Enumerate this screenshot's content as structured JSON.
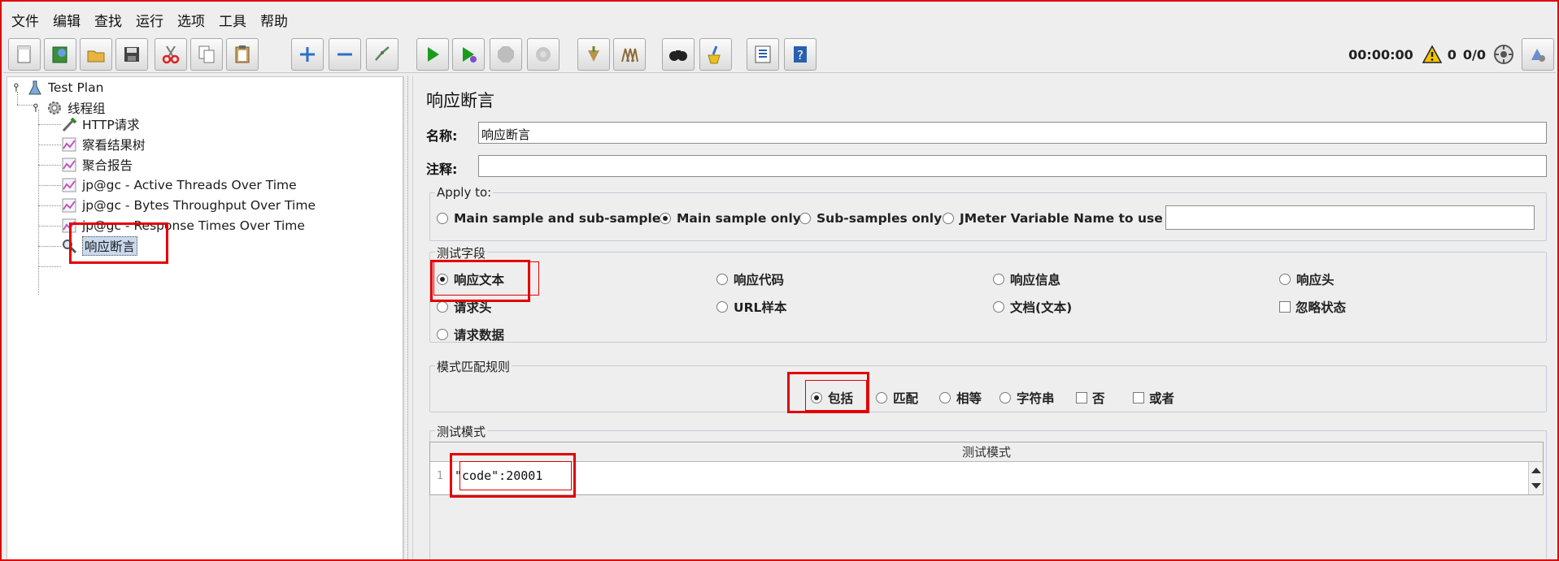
{
  "menu": [
    "文件",
    "编辑",
    "查找",
    "运行",
    "选项",
    "工具",
    "帮助"
  ],
  "toolbar": {
    "buttons": [
      "new-icon",
      "templates-icon",
      "open-icon",
      "save-icon",
      "cut-icon",
      "copy-icon",
      "paste-icon",
      "expand-icon",
      "collapse-icon",
      "toggle-icon",
      "start-icon",
      "start-no-pauses-icon",
      "stop-icon",
      "shutdown-icon",
      "clear-icon",
      "clear-all-icon",
      "search-icon",
      "reset-search-icon",
      "function-helper-icon",
      "help-icon"
    ],
    "timer": "00:00:00",
    "warning_count": "0",
    "thread_count": "0/0"
  },
  "tree": {
    "root": "Test Plan",
    "thread_group": "线程组",
    "children": [
      "HTTP请求",
      "察看结果树",
      "聚合报告",
      "jp@gc - Active Threads Over Time",
      "jp@gc - Bytes Throughput Over Time",
      "jp@gc - Response Times Over Time",
      "响应断言"
    ]
  },
  "panel": {
    "title": "响应断言",
    "name_label": "名称:",
    "name_value": "响应断言",
    "comment_label": "注释:",
    "comment_value": "",
    "apply_to": {
      "title": "Apply to:",
      "options": [
        "Main sample and sub-samples",
        "Main sample only",
        "Sub-samples only",
        "JMeter Variable Name to use"
      ],
      "selected": "Main sample only",
      "variable_value": ""
    },
    "test_field": {
      "title": "测试字段",
      "options": [
        "响应文本",
        "响应代码",
        "响应信息",
        "响应头",
        "请求头",
        "URL样本",
        "文档(文本)",
        "请求数据"
      ],
      "selected": "响应文本",
      "ignore_status_label": "忽略状态",
      "ignore_status_checked": false
    },
    "pattern_rules": {
      "title": "模式匹配规则",
      "options": [
        "包括",
        "匹配",
        "相等",
        "字符串"
      ],
      "selected": "包括",
      "checkboxes": [
        "否",
        "或者"
      ]
    },
    "test_patterns": {
      "title": "测试模式",
      "column_header": "测试模式",
      "rows": [
        {
          "line": "1",
          "value": "\"code\":20001"
        }
      ]
    }
  },
  "colors": {
    "annotation": "#e30000",
    "background": "#eeeeee",
    "selection": "#c9d9ee"
  }
}
